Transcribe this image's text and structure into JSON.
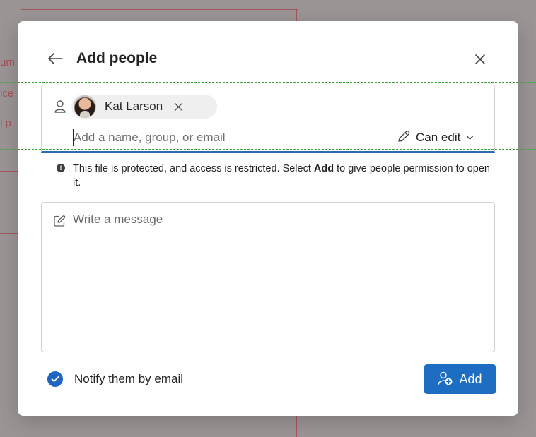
{
  "background": {
    "words": [
      "um",
      "ice",
      "l p"
    ]
  },
  "dialog": {
    "title": "Add people",
    "picker": {
      "selected_people": [
        {
          "name": "Kat Larson"
        }
      ],
      "input_placeholder": "Add a name, group, or email",
      "input_value": "",
      "permission_label": "Can edit"
    },
    "info": {
      "text_before": "This file is protected, and access is restricted. Select ",
      "text_bold": "Add",
      "text_after": " to give people permission to open it."
    },
    "message": {
      "placeholder": "Write a message",
      "value": ""
    },
    "notify": {
      "label": "Notify them by email",
      "checked": true
    },
    "add_button_label": "Add"
  },
  "colors": {
    "accent": "#1d6ec2",
    "picker_underline": "#2b6cb0",
    "guide_dash": "#3fa33a",
    "background_lines": "#a8424a"
  },
  "icons": {
    "back": "arrow-left-icon",
    "close": "close-icon",
    "person": "person-icon",
    "chip_remove": "close-icon",
    "permission": "pencil-icon",
    "chevron": "chevron-down-icon",
    "info": "info-icon",
    "compose": "compose-icon",
    "check": "checkmark-icon",
    "add_person": "person-add-icon"
  }
}
